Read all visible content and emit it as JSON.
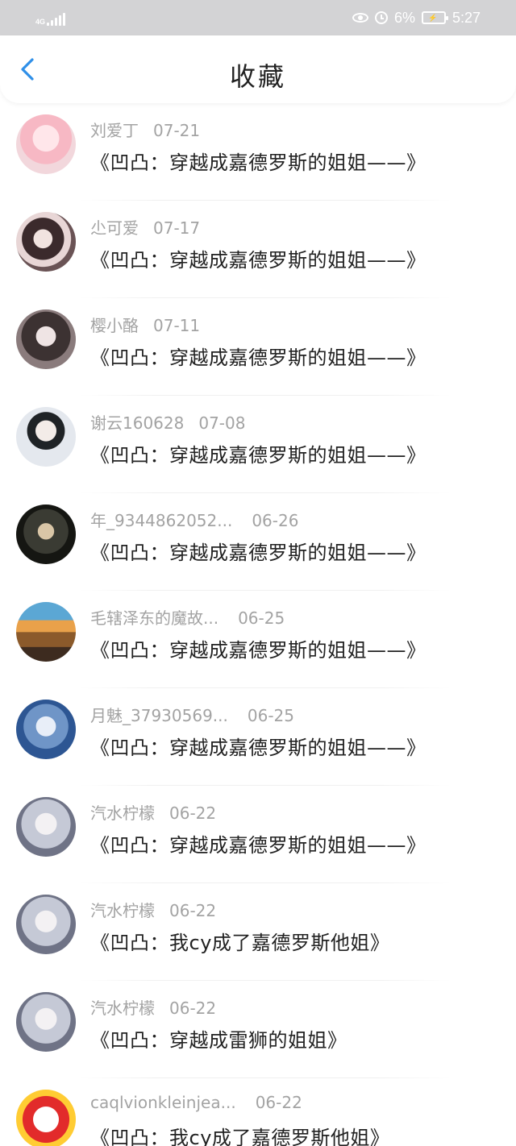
{
  "status_bar": {
    "network": "4G",
    "battery_percent": "6%",
    "time": "5:27"
  },
  "header": {
    "title": "收藏"
  },
  "favorites": [
    {
      "author": "刘爱丁",
      "date": "07-21",
      "title": "《凹凸：穿越成嘉德罗斯的姐姐——》"
    },
    {
      "author": "尐可爱",
      "date": "07-17",
      "title": "《凹凸：穿越成嘉德罗斯的姐姐——》"
    },
    {
      "author": "樱小酪",
      "date": "07-11",
      "title": "《凹凸：穿越成嘉德罗斯的姐姐——》"
    },
    {
      "author": "谢云160628",
      "date": "07-08",
      "title": "《凹凸：穿越成嘉德罗斯的姐姐——》"
    },
    {
      "author": "年_9344862052...",
      "date": "06-26",
      "title": "《凹凸：穿越成嘉德罗斯的姐姐——》"
    },
    {
      "author": "毛辖泽东的魔故...",
      "date": "06-25",
      "title": "《凹凸：穿越成嘉德罗斯的姐姐——》"
    },
    {
      "author": "月魅_37930569...",
      "date": "06-25",
      "title": "《凹凸：穿越成嘉德罗斯的姐姐——》"
    },
    {
      "author": "汽水柠檬",
      "date": "06-22",
      "title": "《凹凸：穿越成嘉德罗斯的姐姐——》"
    },
    {
      "author": "汽水柠檬",
      "date": "06-22",
      "title": "《凹凸：我cy成了嘉德罗斯他姐》"
    },
    {
      "author": "汽水柠檬",
      "date": "06-22",
      "title": "《凹凸：穿越成雷狮的姐姐》"
    },
    {
      "author": "caqlvionkleinjea...",
      "date": "06-22",
      "title": "《凹凸：我cy成了嘉德罗斯他姐》"
    }
  ],
  "colors": {
    "status_bar_bg": "#d3d3d5",
    "accent": "#2f8fe8",
    "meta_text": "#a3a3a3",
    "title_text": "#222222"
  }
}
